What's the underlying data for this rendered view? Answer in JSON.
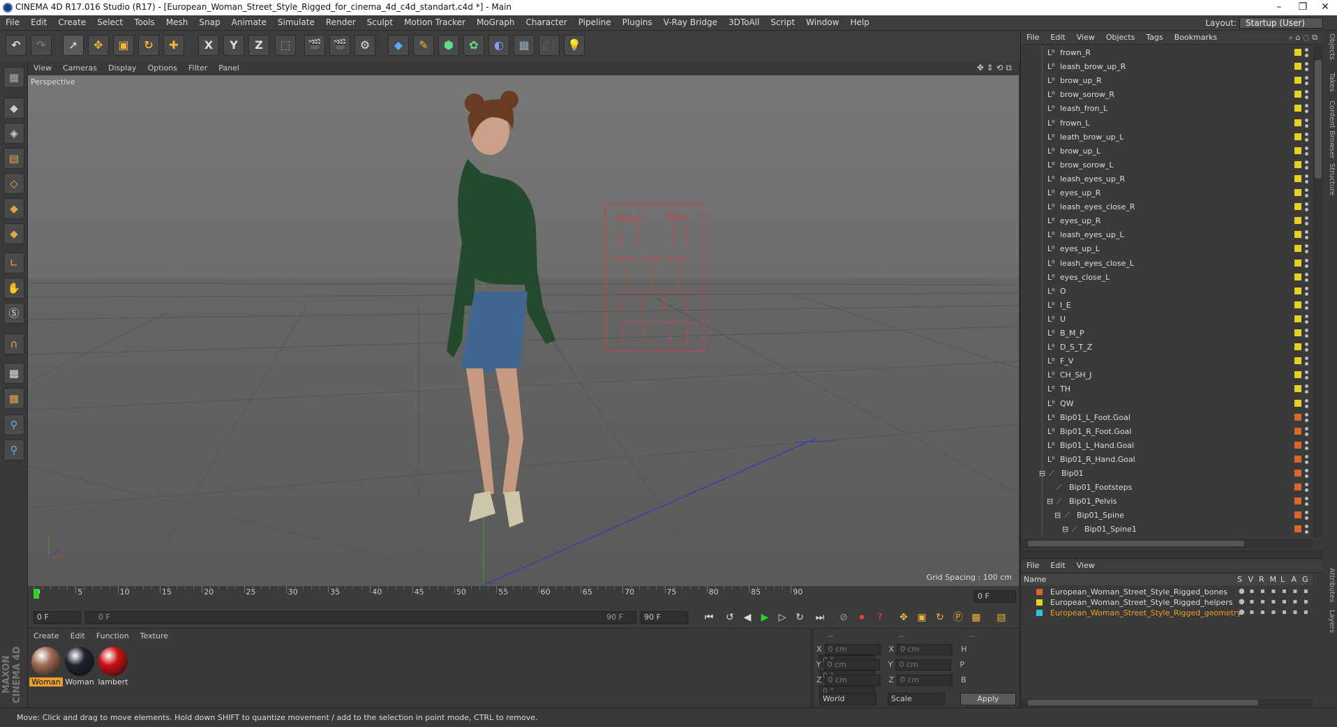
{
  "window": {
    "title": "CINEMA 4D R17.016 Studio (R17) - [European_Woman_Street_Style_Rigged_for_cinema_4d_c4d_standart.c4d *] - Main",
    "minimize": "–",
    "maximize": "❐",
    "close": "✕"
  },
  "menubar": {
    "items": [
      "File",
      "Edit",
      "Create",
      "Select",
      "Tools",
      "Mesh",
      "Snap",
      "Animate",
      "Simulate",
      "Render",
      "Sculpt",
      "Motion Tracker",
      "MoGraph",
      "Character",
      "Pipeline",
      "Plugins",
      "V-Ray Bridge",
      "3DToAll",
      "Script",
      "Window",
      "Help"
    ],
    "layout_label": "Layout:",
    "layout_value": "Startup (User)"
  },
  "toolbar": {
    "icons": [
      "undo-icon",
      "redo-icon",
      "select-icon",
      "move-icon",
      "scale-icon",
      "rotate-icon",
      "move-add-icon",
      "x-axis-icon",
      "y-axis-icon",
      "z-axis-icon",
      "coord-system-icon",
      "render-view-icon",
      "render-picture-icon",
      "render-settings-icon",
      "cube-icon",
      "pen-icon",
      "subdivision-icon",
      "mograph-icon",
      "deformer-icon",
      "floor-icon",
      "camera-icon",
      "light-icon"
    ],
    "axis_x": "X",
    "axis_y": "Y",
    "axis_z": "Z"
  },
  "viewport_menu": {
    "items": [
      "View",
      "Cameras",
      "Display",
      "Options",
      "Filter",
      "Panel"
    ]
  },
  "viewport": {
    "label": "Perspective",
    "grid_spacing": "Grid Spacing : 100 cm",
    "board": {
      "title_left": "Brows",
      "title_right": "Eyes",
      "row2_labels": [
        "Smiles",
        "Fright",
        "Anger"
      ]
    }
  },
  "timeline": {
    "ticks": [
      "0",
      "5",
      "10",
      "15",
      "20",
      "25",
      "30",
      "35",
      "40",
      "45",
      "50",
      "55",
      "60",
      "65",
      "70",
      "75",
      "80",
      "85",
      "90"
    ],
    "current_frame": "0 F"
  },
  "controls": {
    "start_frame": "0 F",
    "range_start": "0 F",
    "range_end": "90 F",
    "end_frame": "90 F"
  },
  "material_panel": {
    "menu": [
      "Create",
      "Edit",
      "Function",
      "Texture"
    ],
    "materials": [
      {
        "name": "Woman",
        "color": "#a06a52",
        "selected": true
      },
      {
        "name": "Woman",
        "color": "#1d2330",
        "selected": false
      },
      {
        "name": "lambert",
        "color": "#cc1010",
        "selected": false
      }
    ]
  },
  "coordinates": {
    "header": [
      "--",
      "--",
      "--"
    ],
    "rows": [
      {
        "a": "X",
        "av": "0 cm",
        "b": "X",
        "bv": "0 cm",
        "c": "H",
        "cv": "0 °"
      },
      {
        "a": "Y",
        "av": "0 cm",
        "b": "Y",
        "bv": "0 cm",
        "c": "P",
        "cv": "0 °"
      },
      {
        "a": "Z",
        "av": "0 cm",
        "b": "Z",
        "bv": "0 cm",
        "c": "B",
        "cv": "0 °"
      }
    ],
    "mode": "World",
    "transform": "Scale",
    "apply": "Apply"
  },
  "status": {
    "text": "Move: Click and drag to move elements. Hold down SHIFT to quantize movement / add to the selection in point mode, CTRL to remove."
  },
  "branding": "MAXON CINEMA 4D",
  "object_manager": {
    "menu": [
      "File",
      "Edit",
      "View",
      "Objects",
      "Tags",
      "Bookmarks"
    ],
    "objects": [
      {
        "name": "frown_R",
        "type": "null",
        "color": "#e8d020"
      },
      {
        "name": "leash_brow_up_R",
        "type": "null",
        "color": "#e8d020"
      },
      {
        "name": "brow_up_R",
        "type": "null",
        "color": "#e8d020"
      },
      {
        "name": "brow_sorow_R",
        "type": "null",
        "color": "#e8d020"
      },
      {
        "name": "leash_fron_L",
        "type": "null",
        "color": "#e8d020"
      },
      {
        "name": "frown_L",
        "type": "null",
        "color": "#e8d020"
      },
      {
        "name": "leath_brow_up_L",
        "type": "null",
        "color": "#e8d020"
      },
      {
        "name": "brow_up_L",
        "type": "null",
        "color": "#e8d020"
      },
      {
        "name": "brow_sorow_L",
        "type": "null",
        "color": "#e8d020"
      },
      {
        "name": "leash_eyes_up_R",
        "type": "null",
        "color": "#e8d020"
      },
      {
        "name": "eyes_up_R",
        "type": "null",
        "color": "#e8d020"
      },
      {
        "name": "leash_eyes_close_R",
        "type": "null",
        "color": "#e8d020"
      },
      {
        "name": "eyes_up_R",
        "type": "null",
        "color": "#e8d020"
      },
      {
        "name": "leash_eyes_up_L",
        "type": "null",
        "color": "#e8d020"
      },
      {
        "name": "eyes_up_L",
        "type": "null",
        "color": "#e8d020"
      },
      {
        "name": "leash_eyes_close_L",
        "type": "null",
        "color": "#e8d020"
      },
      {
        "name": "eyes_close_L",
        "type": "null",
        "color": "#e8d020"
      },
      {
        "name": "O",
        "type": "null",
        "color": "#e8d020"
      },
      {
        "name": "I_E",
        "type": "null",
        "color": "#e8d020"
      },
      {
        "name": "U",
        "type": "null",
        "color": "#e8d020"
      },
      {
        "name": "B_M_P",
        "type": "null",
        "color": "#e8d020"
      },
      {
        "name": "D_S_T_Z",
        "type": "null",
        "color": "#e8d020"
      },
      {
        "name": "F_V",
        "type": "null",
        "color": "#e8d020"
      },
      {
        "name": "CH_SH_J",
        "type": "null",
        "color": "#e8d020"
      },
      {
        "name": "TH",
        "type": "null",
        "color": "#e8d020"
      },
      {
        "name": "QW",
        "type": "null",
        "color": "#e8d020"
      },
      {
        "name": "Bip01_L_Foot.Goal",
        "type": "null",
        "color": "#d8662a"
      },
      {
        "name": "Bip01_R_Foot.Goal",
        "type": "null",
        "color": "#d8662a"
      },
      {
        "name": "Bip01_L_Hand.Goal",
        "type": "null",
        "color": "#d8662a"
      },
      {
        "name": "Bip01_R_Hand.Goal",
        "type": "null",
        "color": "#d8662a"
      },
      {
        "name": "Bip01",
        "type": "bone",
        "color": "#d8662a",
        "depth": 0,
        "expanded": true
      },
      {
        "name": "Bip01_Footsteps",
        "type": "bone",
        "color": "#d8662a",
        "depth": 1
      },
      {
        "name": "Bip01_Pelvis",
        "type": "bone",
        "color": "#d8662a",
        "depth": 1,
        "expanded": true
      },
      {
        "name": "Bip01_Spine",
        "type": "bone",
        "color": "#d8662a",
        "depth": 2,
        "expanded": true
      },
      {
        "name": "Bip01_Spine1",
        "type": "bone",
        "color": "#d8662a",
        "depth": 3,
        "expanded": true
      }
    ]
  },
  "layer_manager": {
    "menu": [
      "File",
      "Edit",
      "View"
    ],
    "columns": [
      "Name",
      "S",
      "V",
      "R",
      "M",
      "L",
      "A",
      "G"
    ],
    "layers": [
      {
        "name": "European_Woman_Street_Style_Rigged_bones",
        "color": "#d8662a",
        "highlight": false
      },
      {
        "name": "European_Woman_Street_Style_Rigged_helpers",
        "color": "#e8d020",
        "highlight": false
      },
      {
        "name": "European_Woman_Street_Style_Rigged_geometry",
        "color": "#2bc6d8",
        "highlight": true
      }
    ]
  },
  "side_tabs": [
    "Objects",
    "Takes",
    "Content Browser",
    "Structure",
    "Attributes",
    "Layers"
  ]
}
